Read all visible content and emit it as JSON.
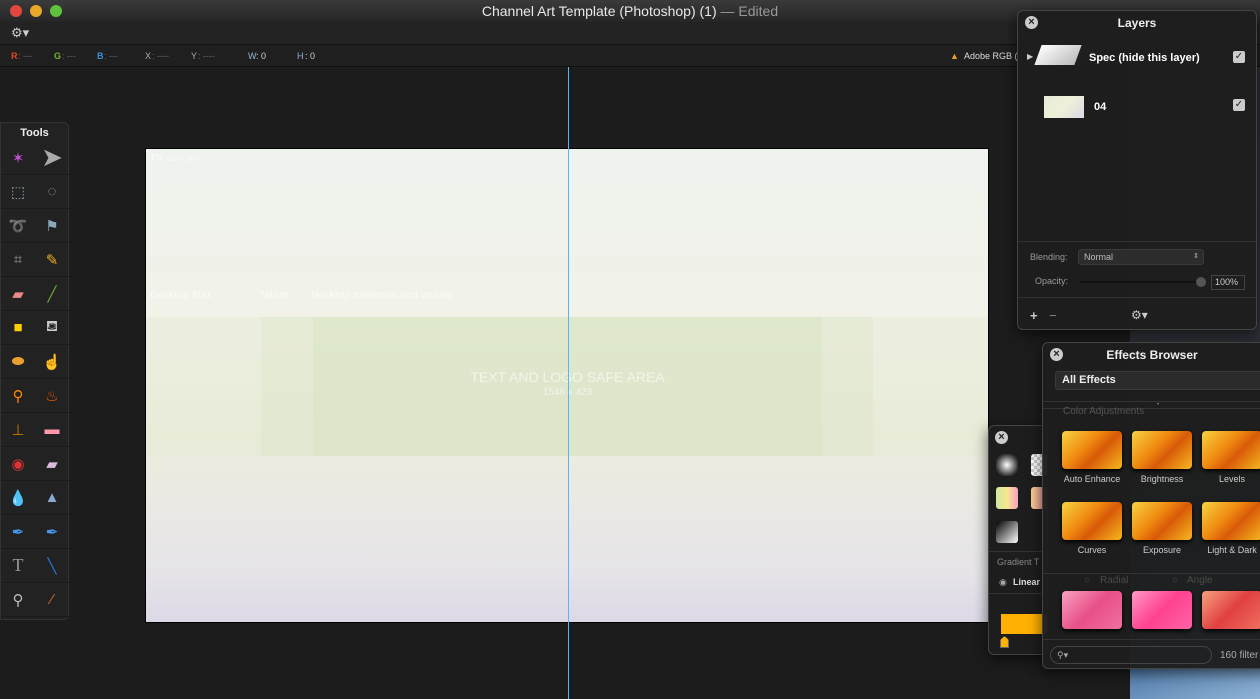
{
  "window": {
    "title": "Channel Art Template (Photoshop) (1)",
    "status": "— Edited"
  },
  "infobar": {
    "r_label": "R",
    "r_val": ": ---",
    "g_label": "G",
    "g_val": ": ---",
    "b_label": "B",
    "b_val": ": ---",
    "x_label": "X",
    "x_val": ": ----",
    "y_label": "Y",
    "y_val": ": ----",
    "w_label": "W",
    "w_val": ": 0",
    "h_label": "H",
    "h_val": ": 0",
    "color_profile": "Adobe RGB ("
  },
  "tools": {
    "title": "Tools",
    "items": [
      "magic-wand",
      "move",
      "rect-select",
      "ellipse-select",
      "lasso",
      "polygon-lasso",
      "crop",
      "pencil",
      "eraser",
      "brush",
      "color-fill",
      "paint-bucket",
      "sponge",
      "smudge",
      "burn",
      "fire",
      "clone-stamp",
      "bandage",
      "red-eye",
      "eraser-2",
      "blur",
      "sharpen",
      "pen",
      "pen-path",
      "text",
      "line",
      "zoom",
      "eyedropper"
    ]
  },
  "canvas": {
    "tv_label": "TV",
    "tv_size": "2560 x 1440",
    "desktop_max": "Desktop Max",
    "tablet": "Tablet",
    "desktop_min": "Desktop minimum and mobile",
    "safe_title": "TEXT AND LOGO SAFE AREA",
    "safe_size": "1546 x 423"
  },
  "layers": {
    "title": "Layers",
    "items": [
      {
        "name": "Spec (hide this layer)",
        "visible": true
      },
      {
        "name": "04",
        "visible": true
      }
    ],
    "blending_label": "Blending:",
    "blending_value": "Normal",
    "opacity_label": "Opacity:",
    "opacity_value": "100%"
  },
  "gradient": {
    "type_label": "Gradient T",
    "linear": "Linear",
    "radial": "Radial",
    "angle": "Angle",
    "stop_color": "#ffb000"
  },
  "effects": {
    "title": "Effects Browser",
    "category": "All Effects",
    "section": "Color Adjustments",
    "items": [
      "Auto Enhance",
      "Brightness",
      "Levels",
      "Curves",
      "Exposure",
      "Light & Dark"
    ],
    "count": "160 filter"
  },
  "colors": {
    "guide": "#4fb8ff",
    "accent": "#ffb000"
  }
}
